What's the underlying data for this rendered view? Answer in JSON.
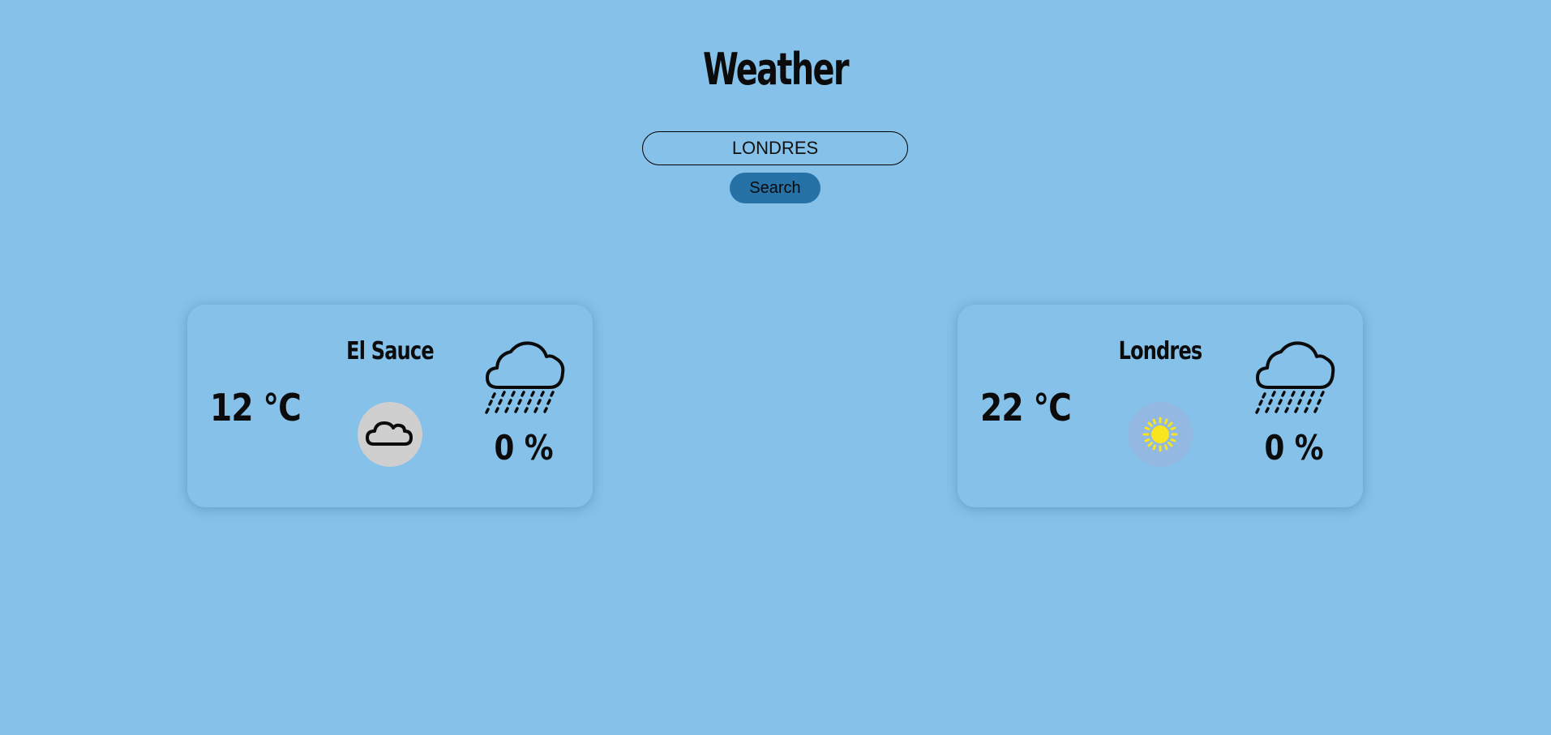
{
  "header": {
    "title": "Weather"
  },
  "search": {
    "value": "LONDRES",
    "button_label": "Search"
  },
  "cards": [
    {
      "city": "El Sauce",
      "temperature": "12 °C",
      "condition_icon": "cloud-icon",
      "precipitation_icon": "rain-cloud-icon",
      "precipitation": "0 %"
    },
    {
      "city": "Londres",
      "temperature": "22 °C",
      "condition_icon": "sun-icon",
      "precipitation_icon": "rain-cloud-icon",
      "precipitation": "0 %"
    }
  ],
  "colors": {
    "background": "#85c1e9",
    "button": "#2671a6",
    "cloud_icon_bg": "#cfcfcf",
    "sun_icon_bg": "#93b8e2",
    "sun": "#f7e51e"
  }
}
